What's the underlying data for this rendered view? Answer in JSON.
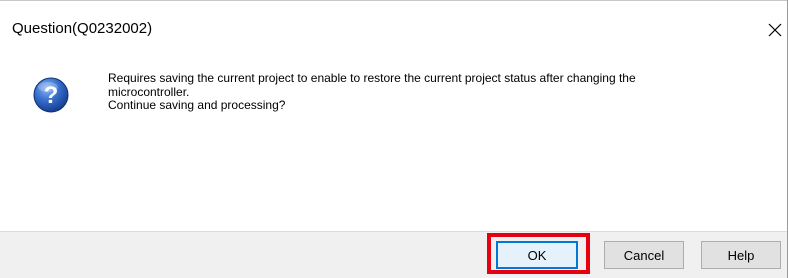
{
  "dialog": {
    "title": "Question(Q0232002)",
    "close_icon": "close-icon"
  },
  "message": {
    "icon": "question-icon",
    "icon_glyph": "?",
    "lines": [
      "Requires saving the current project to enable to restore the current project status after changing the",
      "microcontroller.",
      "Continue saving and processing?"
    ]
  },
  "buttons": {
    "ok": "OK",
    "cancel": "Cancel",
    "help": "Help"
  },
  "colors": {
    "highlight": "#e60012",
    "focus_border": "#0078d7",
    "icon_blue": "#1a4fa8",
    "footer_bg": "#f0f0f0"
  }
}
